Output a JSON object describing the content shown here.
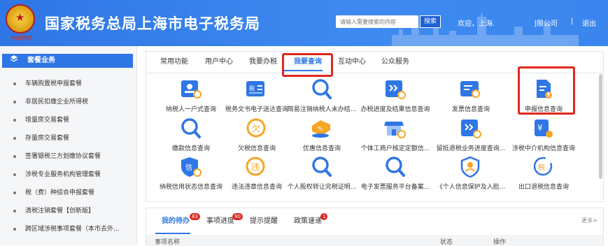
{
  "header": {
    "emblem_text": "中国税务",
    "title": "国家税务总局上海市电子税务局",
    "search_placeholder": "请输入需要搜索的内容",
    "search_label": "搜索",
    "greeting": "欢迎，上海.",
    "company": "]限公司",
    "separator": "|",
    "logout": "退出"
  },
  "sidebar": {
    "title": "套餐业务",
    "items": [
      "车辆购置税申报套餐",
      "非居民扣缴企业所得税",
      "增量房交易套餐",
      "存量房交易套餐",
      "签署银税三方划缴协议套餐",
      "涉税专业服务机构管理套餐",
      "税（费）种综合申报套餐",
      "清税注销套餐【创新版】",
      "跨区域涉税事项套餐（本市去外..."
    ]
  },
  "tabs": [
    "常用功能",
    "用户中心",
    "我要办税",
    "我要查询",
    "互动中心",
    "公众服务"
  ],
  "active_tab": "我要查询",
  "tiles": [
    {
      "label": "纳税人一户式查询",
      "icon": "person-search-icon"
    },
    {
      "label": "税务文书电子送达查询",
      "icon": "tax-document-icon"
    },
    {
      "label": "简易注销纳税人未办结...",
      "icon": "magnifier-icon"
    },
    {
      "label": "办税进度及结果信息查询",
      "icon": "progress-search-icon"
    },
    {
      "label": "发票信息查询",
      "icon": "invoice-search-icon"
    },
    {
      "label": "申报信息查询",
      "icon": "declaration-info-icon"
    },
    {
      "label": "缴款信息查询",
      "icon": "magnifier-icon"
    },
    {
      "label": "欠税信息查询",
      "icon": "owed-tax-icon"
    },
    {
      "label": "优惠信息查询",
      "icon": "discount-icon"
    },
    {
      "label": "个体工商户核定定额信...",
      "icon": "shop-icon"
    },
    {
      "label": "留抵退税业务进度查询...",
      "icon": "refund-progress-icon"
    },
    {
      "label": "涉税中介机构信息查询",
      "icon": "agency-icon"
    },
    {
      "label": "纳税信用状态信息查询",
      "icon": "credit-shield-icon"
    },
    {
      "label": "违法违章信息查询",
      "icon": "violation-icon"
    },
    {
      "label": "个人股权转让完税证明...",
      "icon": "magnifier-icon"
    },
    {
      "label": "电子发票服务平台备案...",
      "icon": "magnifier-icon"
    },
    {
      "label": "《个人信息保护及入脸...",
      "icon": "privacy-shield-icon"
    },
    {
      "label": "出口退税信息查询",
      "icon": "export-refund-icon"
    }
  ],
  "bottom": {
    "tabs": [
      {
        "label": "我的待办",
        "badge": "83"
      },
      {
        "label": "事项进度",
        "badge": "90"
      },
      {
        "label": "提示提醒",
        "badge": ""
      },
      {
        "label": "政策速递",
        "badge": "1"
      }
    ],
    "more": "更多>",
    "columns": [
      "事项名称",
      "状态",
      "操作"
    ]
  },
  "colors": {
    "primary": "#2f76e6",
    "highlight_box": "#e0281e",
    "accent_orange": "#f5a623"
  }
}
